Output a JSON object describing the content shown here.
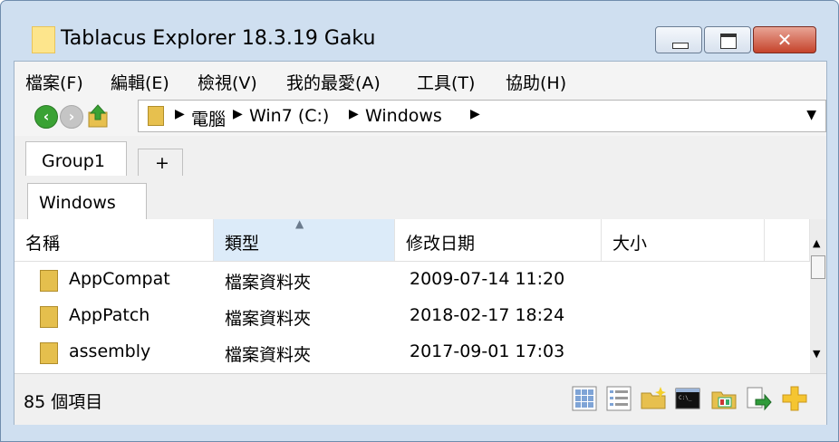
{
  "window": {
    "title": "Tablacus Explorer 18.3.19 Gaku",
    "controls": {
      "minimize": "minimize",
      "maximize": "maximize",
      "close": "✕"
    }
  },
  "menu": [
    "檔案(F)",
    "編輯(E)",
    "檢視(V)",
    "我的最愛(A)",
    "工具(T)",
    "協助(H)"
  ],
  "navigation": {
    "breadcrumb": [
      "電腦",
      "Win7 (C:)",
      "Windows"
    ],
    "icons": [
      "back-arrow-icon",
      "forward-arrow-icon",
      "up-folder-icon",
      "folder-icon",
      "dropdown-arrow-icon"
    ]
  },
  "tabs": {
    "groups": [
      "Group1"
    ],
    "add_label": "+",
    "folder_tabs": [
      "Windows"
    ]
  },
  "columns": [
    "名稱",
    "類型",
    "修改日期",
    "大小"
  ],
  "rows": [
    {
      "name": "AppCompat",
      "type": "檔案資料夾",
      "date": "2009-07-14 11:20",
      "size": ""
    },
    {
      "name": "AppPatch",
      "type": "檔案資料夾",
      "date": "2018-02-17 18:24",
      "size": ""
    },
    {
      "name": "assembly",
      "type": "檔案資料夾",
      "date": "2017-09-01 17:03",
      "size": ""
    }
  ],
  "status": {
    "item_count": "85 個項目"
  },
  "toolbar_icons": [
    "grid-view-icon",
    "details-view-icon",
    "new-folder-icon",
    "command-prompt-icon",
    "properties-icon",
    "move-icon",
    "add-icon"
  ],
  "colors": {
    "accent": "#cfdff0",
    "sorted_column": "#dcebf9",
    "close_button": "#c5432b"
  }
}
